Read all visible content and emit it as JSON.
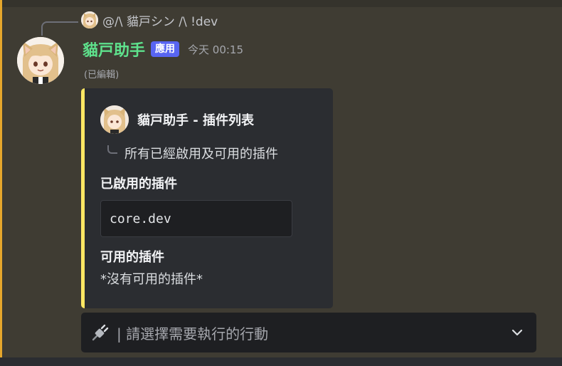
{
  "reply": {
    "text": "@/\\ 貓戸シン /\\ !dev"
  },
  "message": {
    "username": "貓戸助手",
    "badge": "應用",
    "timestamp": "今天 00:15",
    "edited": "(已編輯)"
  },
  "embed": {
    "accent_color": "#ffe763",
    "author_title": "貓戸助手 - 插件列表",
    "description": "所有已經啟用及可用的插件",
    "fields": [
      {
        "name": "已啟用的插件",
        "code": "core.dev"
      },
      {
        "name": "可用的插件",
        "value": "*沒有可用的插件*"
      }
    ]
  },
  "select_menu": {
    "icon": "plug-icon",
    "placeholder": "| 請選擇需要執行的行動",
    "chevron": "chevron-down-icon"
  },
  "colors": {
    "username": "#5ee18c",
    "badge": "#5865f2",
    "highlight": "#e6a72c"
  }
}
